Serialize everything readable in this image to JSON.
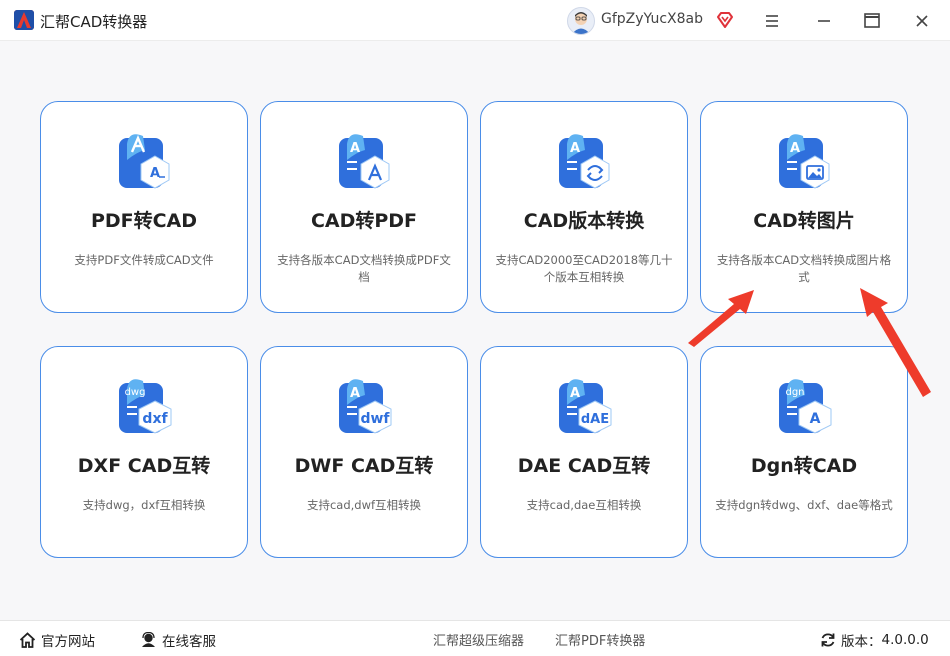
{
  "app": {
    "title": "汇帮CAD转换器"
  },
  "user": {
    "name": "GfpZyYucX8ab"
  },
  "cards": [
    {
      "title": "PDF转CAD",
      "desc": "支持PDF文件转成CAD文件",
      "icon": "pdf-to-cad-icon"
    },
    {
      "title": "CAD转PDF",
      "desc": "支持各版本CAD文档转换成PDF文档",
      "icon": "cad-to-pdf-icon"
    },
    {
      "title": "CAD版本转换",
      "desc": "支持CAD2000至CAD2018等几十个版本互相转换",
      "icon": "cad-version-icon"
    },
    {
      "title": "CAD转图片",
      "desc": "支持各版本CAD文档转换成图片格式",
      "icon": "cad-to-image-icon"
    },
    {
      "title": "DXF CAD互转",
      "desc": "支持dwg，dxf互相转换",
      "icon": "dxf-icon",
      "badge": "dxf",
      "tag": "dwg"
    },
    {
      "title": "DWF CAD互转",
      "desc": "支持cad,dwf互相转换",
      "icon": "dwf-icon",
      "badge": "dwf",
      "tag": "A"
    },
    {
      "title": "DAE CAD互转",
      "desc": "支持cad,dae互相转换",
      "icon": "dae-icon",
      "badge": "dAE",
      "tag": "A"
    },
    {
      "title": "Dgn转CAD",
      "desc": "支持dgn转dwg、dxf、dae等格式",
      "icon": "dgn-icon",
      "badge": "A",
      "tag": "dgn"
    }
  ],
  "footer": {
    "website": "官方网站",
    "service": "在线客服",
    "link1": "汇帮超级压缩器",
    "link2": "汇帮PDF转换器",
    "version_label": "版本：",
    "version": "4.0.0.0"
  },
  "colors": {
    "accent": "#4a8de8",
    "arrow": "#ee3b2b",
    "icon_dark": "#2f6fdc",
    "icon_light": "#5fb2f2"
  }
}
